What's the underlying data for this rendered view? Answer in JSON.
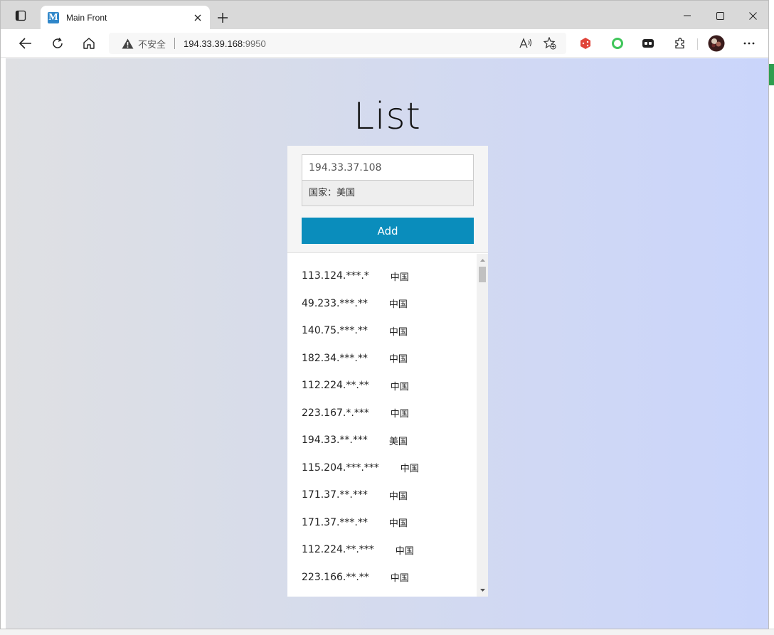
{
  "browser": {
    "tab_title": "Main Front",
    "favicon_letter": "M",
    "address": {
      "security_label": "不安全",
      "host": "194.33.39.168",
      "port": ":9950"
    }
  },
  "page": {
    "title": "List",
    "ip_input_value": "194.33.37.108",
    "country_text": "国家：美国",
    "add_label": "Add"
  },
  "list": [
    {
      "ip": "113.124.***.*",
      "country": "中国"
    },
    {
      "ip": "49.233.***.**",
      "country": "中国"
    },
    {
      "ip": "140.75.***.**",
      "country": "中国"
    },
    {
      "ip": "182.34.***.**",
      "country": "中国"
    },
    {
      "ip": "112.224.**.**",
      "country": "中国"
    },
    {
      "ip": "223.167.*.***",
      "country": "中国"
    },
    {
      "ip": "194.33.**.***",
      "country": "美国"
    },
    {
      "ip": "115.204.***.***",
      "country": "中国"
    },
    {
      "ip": "171.37.**.***",
      "country": "中国"
    },
    {
      "ip": "171.37.***.**",
      "country": "中国"
    },
    {
      "ip": "112.224.**.***",
      "country": "中国"
    },
    {
      "ip": "223.166.**.**",
      "country": "中国"
    }
  ]
}
